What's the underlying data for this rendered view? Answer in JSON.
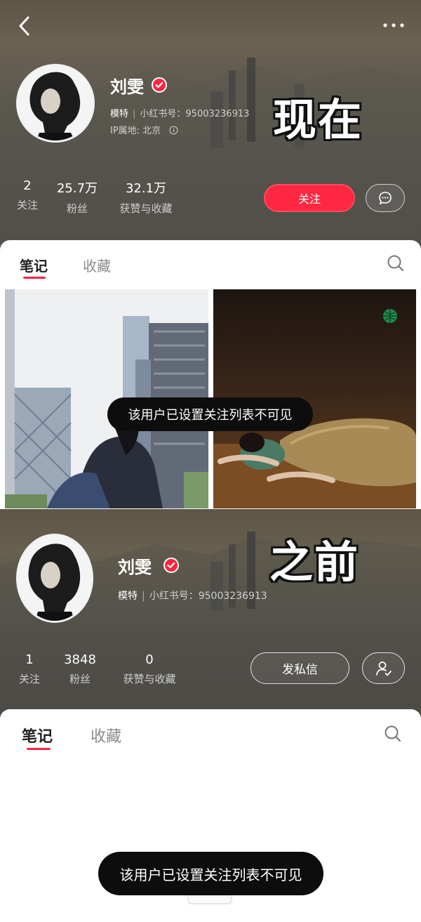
{
  "colors": {
    "brand_red": "#ff2442",
    "dark_header": "#4e4e4d",
    "toast_bg": "#0d0d0d"
  },
  "top": {
    "caption": "现在",
    "profile": {
      "name": "刘雯",
      "role": "模特",
      "id_label": "小红书号：95003236913",
      "ip_label": "IP属地: 北京"
    },
    "stats": [
      {
        "value": "2",
        "label": "关注"
      },
      {
        "value": "25.7万",
        "label": "粉丝"
      },
      {
        "value": "32.1万",
        "label": "获赞与收藏"
      }
    ],
    "follow_label": "关注",
    "tabs": [
      "笔记",
      "收藏"
    ],
    "toast": "该用户已设置关注列表不可见",
    "icons": [
      "back-arrow-icon",
      "more-dots-icon",
      "verified-icon",
      "info-icon",
      "chat-bubble-icon",
      "search-icon",
      "globe-icon"
    ]
  },
  "bottom": {
    "caption": "之前",
    "profile": {
      "name": "刘雯",
      "role": "模特",
      "id_label": "小红书号：95003236913"
    },
    "stats": [
      {
        "value": "1",
        "label": "关注"
      },
      {
        "value": "3848",
        "label": "粉丝"
      },
      {
        "value": "0",
        "label": "获赞与收藏"
      }
    ],
    "dm_label": "发私信",
    "tabs": [
      "笔记",
      "收藏"
    ],
    "toast": "该用户已设置关注列表不可见",
    "icons": [
      "user-check-icon",
      "search-icon"
    ]
  }
}
